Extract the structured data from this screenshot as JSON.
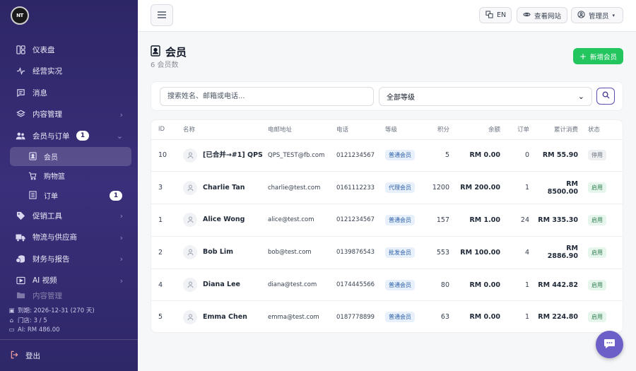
{
  "brand": {
    "logo_text": "NT"
  },
  "sidebar": {
    "items": [
      {
        "label": "仪表盘",
        "icon": "dashboard-icon"
      },
      {
        "label": "经营实况",
        "icon": "pulse-icon"
      },
      {
        "label": "消息",
        "icon": "message-icon"
      },
      {
        "label": "内容管理",
        "icon": "layers-icon"
      },
      {
        "label": "会员与订单",
        "icon": "users-icon",
        "badge": "1"
      },
      {
        "label": "促销工具",
        "icon": "tag-icon"
      },
      {
        "label": "物流与供应商",
        "icon": "truck-icon"
      },
      {
        "label": "财务与报告",
        "icon": "coins-icon"
      },
      {
        "label": "AI 视频",
        "icon": "video-icon"
      },
      {
        "label": "内容管理",
        "icon": "folder-icon"
      }
    ],
    "sub_items": [
      {
        "label": "会员",
        "icon": "member-card-icon"
      },
      {
        "label": "购物篮",
        "icon": "cart-icon"
      },
      {
        "label": "订单",
        "icon": "order-icon",
        "badge": "1"
      }
    ],
    "info": {
      "expiry": "到期: 2026-12-31 (270 天)",
      "stores": "门店: 3 / 5",
      "ai": "AI: RM 486.00"
    },
    "logout_label": "登出"
  },
  "topbar": {
    "lang_label": "EN",
    "view_site_label": "查看网站",
    "admin_label": "管理员"
  },
  "page": {
    "title": "会员",
    "subtitle": "6 会员数",
    "add_label": "新增会员"
  },
  "filters": {
    "search_placeholder": "搜索姓名、邮箱或电话...",
    "level_selected": "全部等级"
  },
  "table": {
    "headers": {
      "id": "ID",
      "name": "名称",
      "email": "电邮地址",
      "phone": "电话",
      "level": "等级",
      "points": "积分",
      "balance": "余额",
      "orders": "订单",
      "spent": "累计消费",
      "status": "状态"
    },
    "rows": [
      {
        "id": "10",
        "name": "[已合并→#1] QPS",
        "email": "QPS_TEST@fb.com",
        "phone": "0121234567",
        "level": "普通会员",
        "points": "5",
        "balance": "RM 0.00",
        "orders": "0",
        "spent": "RM 55.90",
        "status": "停用",
        "active": false
      },
      {
        "id": "3",
        "name": "Charlie Tan",
        "email": "charlie@test.com",
        "phone": "0161112233",
        "level": "代理会员",
        "points": "1200",
        "balance": "RM 200.00",
        "orders": "1",
        "spent": "RM 8500.00",
        "status": "启用",
        "active": true
      },
      {
        "id": "1",
        "name": "Alice Wong",
        "email": "alice@test.com",
        "phone": "0121234567",
        "level": "普通会员",
        "points": "157",
        "balance": "RM 1.00",
        "orders": "24",
        "spent": "RM 335.30",
        "status": "启用",
        "active": true
      },
      {
        "id": "2",
        "name": "Bob Lim",
        "email": "bob@test.com",
        "phone": "0139876543",
        "level": "批发会员",
        "points": "553",
        "balance": "RM 100.00",
        "orders": "4",
        "spent": "RM 2886.90",
        "status": "启用",
        "active": true
      },
      {
        "id": "4",
        "name": "Diana Lee",
        "email": "diana@test.com",
        "phone": "0174445566",
        "level": "普通会员",
        "points": "80",
        "balance": "RM 0.00",
        "orders": "1",
        "spent": "RM 442.82",
        "status": "启用",
        "active": true
      },
      {
        "id": "5",
        "name": "Emma Chen",
        "email": "emma@test.com",
        "phone": "0187778899",
        "level": "普通会员",
        "points": "63",
        "balance": "RM 0.00",
        "orders": "1",
        "spent": "RM 224.80",
        "status": "启用",
        "active": true
      }
    ]
  },
  "colors": {
    "sidebar": "#2d2666",
    "accent": "#22c55e",
    "fab": "#6c5fc7"
  }
}
